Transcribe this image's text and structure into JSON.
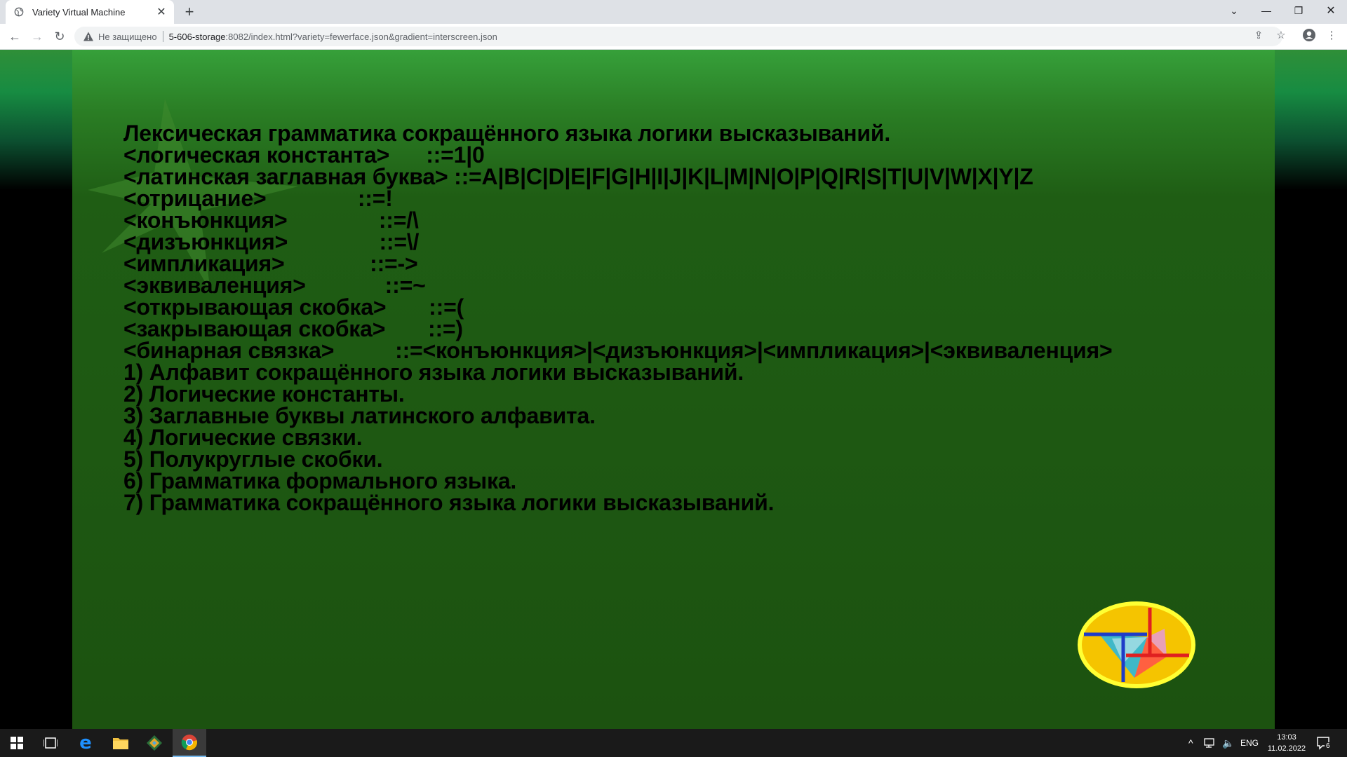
{
  "browser": {
    "tab_title": "Variety Virtual Machine",
    "security_label": "Не защищено",
    "url_host": "5-606-storage",
    "url_path": ":8082/index.html?variety=fewerface.json&gradient=interscreen.json"
  },
  "page": {
    "lines": [
      "Лексическая грамматика сокращённого языка логики высказываний.",
      "<логическая константа>      ::=1|0",
      "<латинская заглавная буква> ::=A|B|C|D|E|F|G|H|I|J|K|L|M|N|O|P|Q|R|S|T|U|V|W|X|Y|Z",
      "<отрицание>               ::=!",
      "<конъюнкция>               ::=/\\",
      "<дизъюнкция>               ::=\\/",
      "<импликация>              ::=->",
      "<эквиваленция>             ::=~",
      "<открывающая скобка>       ::=(",
      "<закрывающая скобка>       ::=)",
      "<бинарная связка>          ::=<конъюнкция>|<дизъюнкция>|<импликация>|<эквиваленция>",
      "1) Алфавит сокращённого языка логики высказываний.",
      "2) Логические константы.",
      "3) Заглавные буквы латинского алфавита.",
      "4) Логические связки.",
      "5) Полукруглые скобки.",
      "6) Грамматика формального языка.",
      "7) Грамматика сокращённого языка логики высказываний."
    ]
  },
  "taskbar": {
    "language": "ENG",
    "time": "13:03",
    "date": "11.02.2022",
    "notification_count": "6"
  },
  "colors": {
    "panel_top": "#36a03a",
    "panel_body": "#1c5210",
    "text": "#000000",
    "logo_fill": "#f5c400",
    "logo_ring": "#ffff00"
  }
}
